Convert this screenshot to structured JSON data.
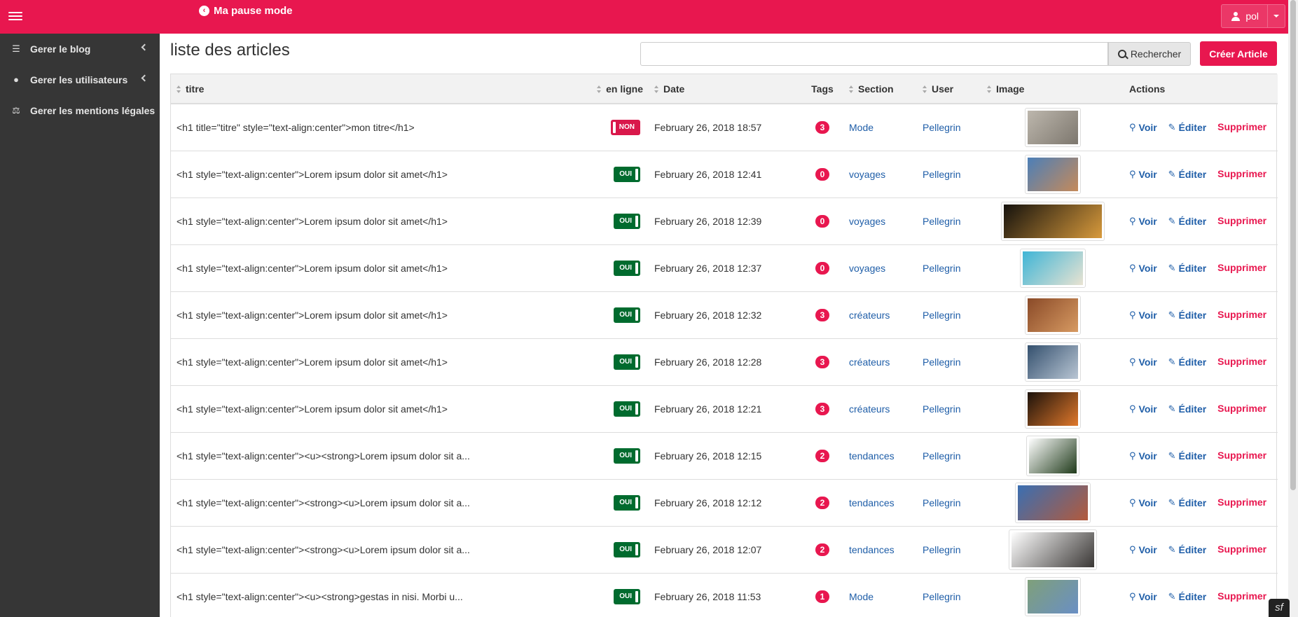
{
  "topbar": {
    "brand": "Ma pause mode",
    "user": "pol",
    "accent_color": "#e8174f"
  },
  "sidebar": {
    "items": [
      {
        "label": "Gerer le blog",
        "icon": "list-icon",
        "expandable": true
      },
      {
        "label": "Gerer les utilisateurs",
        "icon": "user-circle-icon",
        "expandable": true
      },
      {
        "label": "Gerer les mentions légales",
        "icon": "balance-scale-icon",
        "expandable": false
      }
    ]
  },
  "main": {
    "title": "liste des articles",
    "search": {
      "value": "",
      "placeholder": "",
      "button_label": "Rechercher"
    },
    "create_label": "Créer Article"
  },
  "table": {
    "columns": {
      "titre": "titre",
      "en_ligne": "en ligne",
      "date": "Date",
      "tags": "Tags",
      "section": "Section",
      "user": "User",
      "image": "Image",
      "actions": "Actions"
    },
    "action_labels": {
      "voir": "Voir",
      "editer": "Éditer",
      "supprimer": "Supprimer"
    },
    "rows": [
      {
        "titre": "<h1 title=\"titre\" style=\"text-align:center\">mon titre</h1>",
        "en_ligne": "NON",
        "date": "February 26, 2018 18:57",
        "tags": "3",
        "section": "Mode",
        "user": "Pellegrin",
        "img_colors": [
          "#bdb7ad",
          "#7d776e"
        ]
      },
      {
        "titre": "<h1 style=\"text-align:center\">Lorem ipsum dolor sit amet</h1>",
        "en_ligne": "OUI",
        "date": "February 26, 2018 12:41",
        "tags": "0",
        "section": "voyages",
        "user": "Pellegrin",
        "img_colors": [
          "#4c7fb8",
          "#c58a5a"
        ]
      },
      {
        "titre": "<h1 style=\"text-align:center\">Lorem ipsum dolor sit amet</h1>",
        "en_ligne": "OUI",
        "date": "February 26, 2018 12:39",
        "tags": "0",
        "section": "voyages",
        "user": "Pellegrin",
        "img_colors": [
          "#15120d",
          "#d89a3c"
        ]
      },
      {
        "titre": "<h1 style=\"text-align:center\">Lorem ipsum dolor sit amet</h1>",
        "en_ligne": "OUI",
        "date": "February 26, 2018 12:37",
        "tags": "0",
        "section": "voyages",
        "user": "Pellegrin",
        "img_colors": [
          "#3fb5d6",
          "#e9e3d2"
        ]
      },
      {
        "titre": "<h1 style=\"text-align:center\">Lorem ipsum dolor sit amet</h1>",
        "en_ligne": "OUI",
        "date": "February 26, 2018 12:32",
        "tags": "3",
        "section": "créateurs",
        "user": "Pellegrin",
        "img_colors": [
          "#8a4a28",
          "#d79a62"
        ]
      },
      {
        "titre": "<h1 style=\"text-align:center\">Lorem ipsum dolor sit amet</h1>",
        "en_ligne": "OUI",
        "date": "February 26, 2018 12:28",
        "tags": "3",
        "section": "créateurs",
        "user": "Pellegrin",
        "img_colors": [
          "#34506e",
          "#b9c6d4"
        ]
      },
      {
        "titre": "<h1 style=\"text-align:center\">Lorem ipsum dolor sit amet</h1>",
        "en_ligne": "OUI",
        "date": "February 26, 2018 12:21",
        "tags": "3",
        "section": "créateurs",
        "user": "Pellegrin",
        "img_colors": [
          "#1c120b",
          "#e0782b"
        ]
      },
      {
        "titre": "<h1 style=\"text-align:center\"><u><strong>Lorem ipsum dolor sit a...",
        "en_ligne": "OUI",
        "date": "February 26, 2018 12:15",
        "tags": "2",
        "section": "tendances",
        "user": "Pellegrin",
        "img_colors": [
          "#ffffff",
          "#1f3a1a"
        ]
      },
      {
        "titre": "<h1 style=\"text-align:center\"><strong><u>Lorem ipsum dolor sit a...",
        "en_ligne": "OUI",
        "date": "February 26, 2018 12:12",
        "tags": "2",
        "section": "tendances",
        "user": "Pellegrin",
        "img_colors": [
          "#3a6fb2",
          "#b35a3c"
        ]
      },
      {
        "titre": "<h1 style=\"text-align:center\"><strong><u>Lorem ipsum dolor sit a...",
        "en_ligne": "OUI",
        "date": "February 26, 2018 12:07",
        "tags": "2",
        "section": "tendances",
        "user": "Pellegrin",
        "img_colors": [
          "#ffffff",
          "#3a3735"
        ]
      },
      {
        "titre": "<h1 style=\"text-align:center\"><u><strong>gestas in nisi. Morbi u...",
        "en_ligne": "OUI",
        "date": "February 26, 2018 11:53",
        "tags": "1",
        "section": "Mode",
        "user": "Pellegrin",
        "img_colors": [
          "#7fa07a",
          "#6a8fc4"
        ]
      }
    ]
  }
}
